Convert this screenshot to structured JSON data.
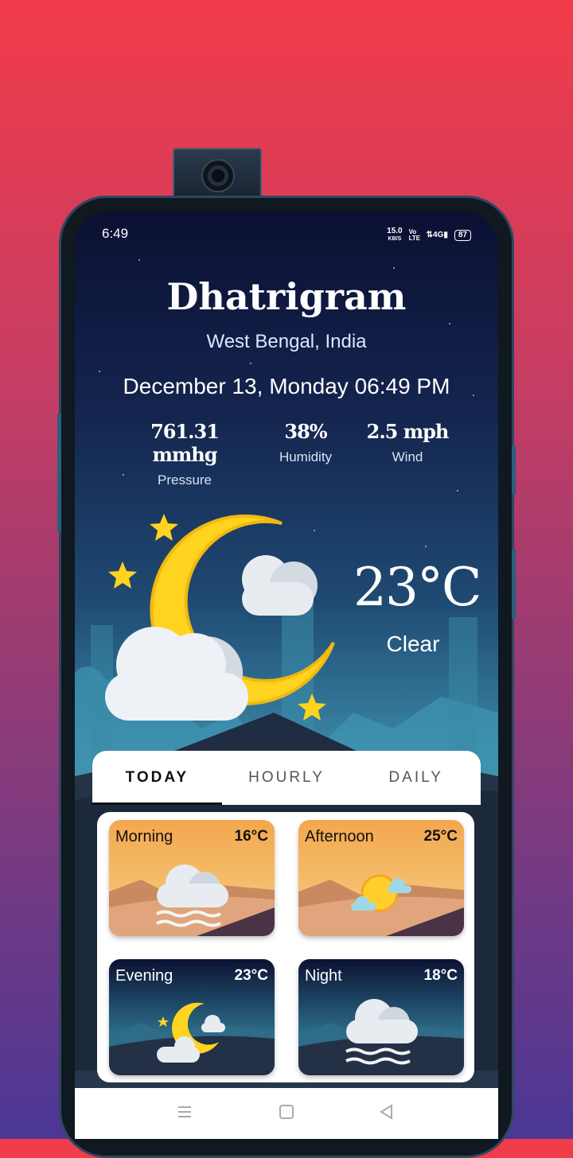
{
  "status_bar": {
    "time": "6:49",
    "net_speed": "15.0",
    "net_unit": "KB/S",
    "volte": "Vo LTE",
    "signal": "4G",
    "battery": "87"
  },
  "location": {
    "city": "Dhatrigram",
    "region": "West Bengal, India"
  },
  "datetime": "December 13, Monday 06:49 PM",
  "stats": [
    {
      "value": "761.31 mmhg",
      "label": "Pressure"
    },
    {
      "value": "38%",
      "label": "Humidity"
    },
    {
      "value": "2.5 mph",
      "label": "Wind"
    }
  ],
  "current": {
    "temperature": "23°C",
    "condition": "Clear"
  },
  "tabs": [
    {
      "label": "TODAY",
      "active": true
    },
    {
      "label": "HOURLY",
      "active": false
    },
    {
      "label": "DAILY",
      "active": false
    }
  ],
  "periods": [
    {
      "name": "Morning",
      "temp": "16°C",
      "icon": "fog-cloud-icon"
    },
    {
      "name": "Afternoon",
      "temp": "25°C",
      "icon": "sun-cloud-icon"
    },
    {
      "name": "Evening",
      "temp": "23°C",
      "icon": "moon-cloud-icon"
    },
    {
      "name": "Night",
      "temp": "18°C",
      "icon": "fog-cloud-icon"
    }
  ],
  "nav": {
    "menu_icon": "menu-icon",
    "home_icon": "home-square-icon",
    "back_icon": "back-triangle-icon"
  },
  "colors": {
    "moon": "#ffd31f",
    "cloud": "#e8ecf1",
    "day_card": "#e9a064",
    "night_card": "#1e2a44"
  }
}
